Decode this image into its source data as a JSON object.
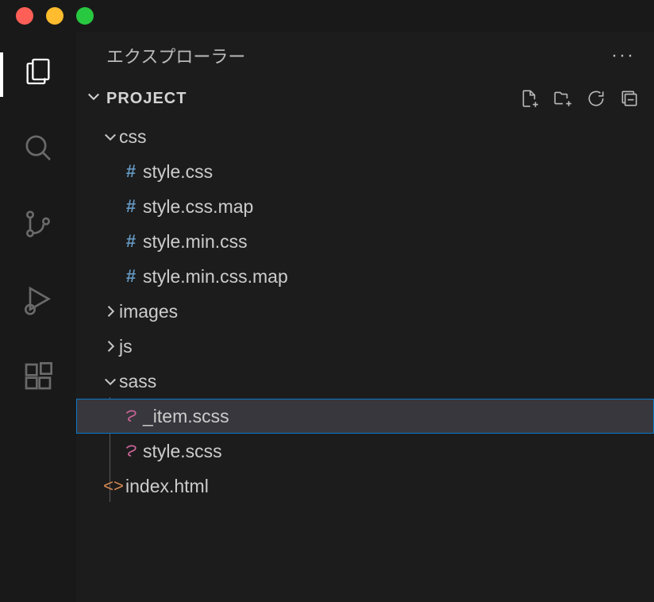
{
  "explorer": {
    "title": "エクスプローラー",
    "project_label": "PROJECT"
  },
  "traffic": {
    "close_color": "#ff5f57",
    "min_color": "#febc2e",
    "max_color": "#28c840"
  },
  "tree": {
    "folders": {
      "css": "css",
      "images": "images",
      "js": "js",
      "sass": "sass"
    },
    "files": {
      "style_css": "style.css",
      "style_css_map": "style.css.map",
      "style_min_css": "style.min.css",
      "style_min_css_map": "style.min.css.map",
      "item_scss": "_item.scss",
      "style_scss": "style.scss",
      "index_html": "index.html"
    }
  }
}
